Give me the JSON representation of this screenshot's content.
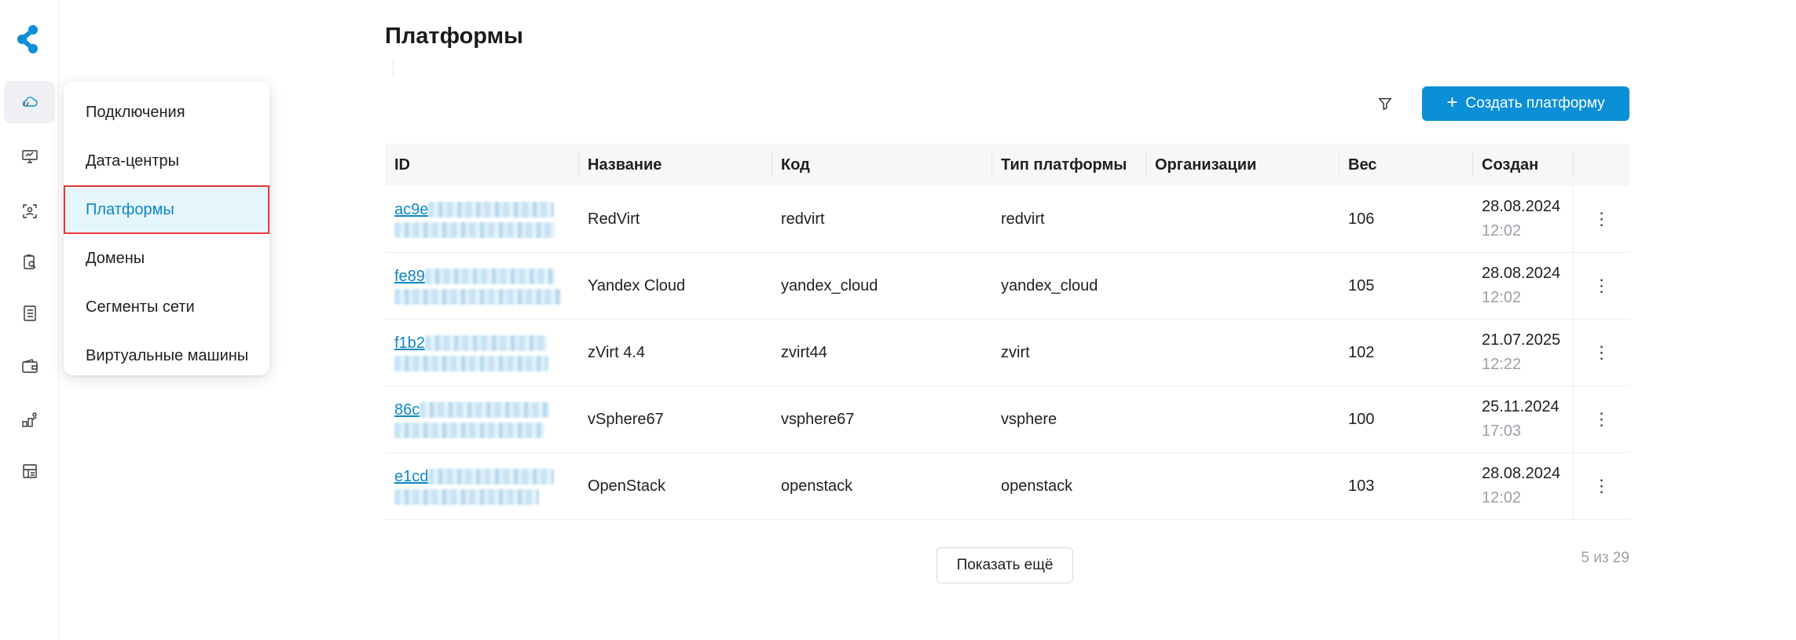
{
  "colors": {
    "accent": "#0b8fd6",
    "link": "#0a86c9",
    "selected_bg": "#e6f6fd",
    "highlight_border": "#e53935",
    "muted": "#9aa0a6"
  },
  "rail": {
    "icons": [
      "logo-icon",
      "cloud-icon",
      "monitor-icon",
      "user-scan-icon",
      "clipboard-search-icon",
      "list-icon",
      "wallet-icon",
      "network-icon",
      "dashboard-icon"
    ]
  },
  "menu": {
    "items": [
      {
        "label": "Подключения"
      },
      {
        "label": "Дата-центры"
      },
      {
        "label": "Платформы"
      },
      {
        "label": "Домены"
      },
      {
        "label": "Сегменты сети"
      },
      {
        "label": "Виртуальные машины"
      }
    ],
    "selected": "Платформы"
  },
  "page": {
    "title": "Платформы",
    "create_label": "Создать платформу",
    "show_more_label": "Показать ещё",
    "count_label": "5 из 29"
  },
  "table": {
    "headers": {
      "id": "ID",
      "name": "Название",
      "code": "Код",
      "type": "Тип платформы",
      "org": "Организации",
      "weight": "Вес",
      "created": "Создан"
    },
    "rows": [
      {
        "id_prefix": "ac9e",
        "name": "RedVirt",
        "code": "redvirt",
        "type": "redvirt",
        "org": "",
        "weight": "106",
        "date": "28.08.2024",
        "time": "12:02"
      },
      {
        "id_prefix": "fe89",
        "name": "Yandex Cloud",
        "code": "yandex_cloud",
        "type": "yandex_cloud",
        "org": "",
        "weight": "105",
        "date": "28.08.2024",
        "time": "12:02"
      },
      {
        "id_prefix": "f1b2",
        "name": "zVirt 4.4",
        "code": "zvirt44",
        "type": "zvirt",
        "org": "",
        "weight": "102",
        "date": "21.07.2025",
        "time": "12:22"
      },
      {
        "id_prefix": "86c",
        "name": "vSphere67",
        "code": "vsphere67",
        "type": "vsphere",
        "org": "",
        "weight": "100",
        "date": "25.11.2024",
        "time": "17:03"
      },
      {
        "id_prefix": "e1cd",
        "name": "OpenStack",
        "code": "openstack",
        "type": "openstack",
        "org": "",
        "weight": "103",
        "date": "28.08.2024",
        "time": "12:02"
      }
    ]
  }
}
